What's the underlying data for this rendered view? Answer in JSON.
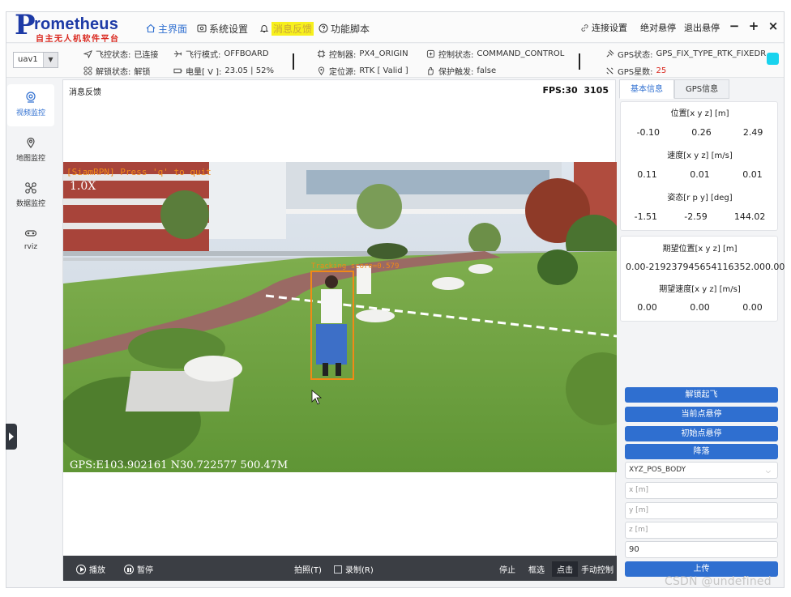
{
  "app": {
    "logo_letter": "P",
    "logo_word": "rometheus",
    "logo_sub": "自主无人机软件平台"
  },
  "nav": {
    "home": "主界面",
    "settings": "系统设置",
    "alerts": "消息反馈",
    "scripts": "功能脚本"
  },
  "topright": {
    "connect": "连接设置",
    "abs_hover": "绝对悬停",
    "exit_hover": "退出悬停",
    "minimize": "−",
    "maximize": "+",
    "close": "×"
  },
  "status": {
    "uav_select": "uav1",
    "fc_state_label": "飞控状态:",
    "fc_state_value": "已连接",
    "flight_mode_label": "飞行模式:",
    "flight_mode_value": "OFFBOARD",
    "controller_label": "控制器:",
    "controller_value": "PX4_ORIGIN",
    "control_state_label": "控制状态:",
    "control_state_value": "COMMAND_CONTROL",
    "gps_state_label": "GPS状态:",
    "gps_state_value": "GPS_FIX_TYPE_RTK_FIXEDR",
    "unlock_label": "解锁状态:",
    "unlock_value": "解锁",
    "battery_label": "电量[ V ]:",
    "battery_value": "23.05 | 52%",
    "position_src_label": "定位源:",
    "position_src_value": "RTK [ Valid ]",
    "protect_label": "保护触发:",
    "protect_value": "false",
    "gps_sat_label": "GPS星数:",
    "gps_sat_value": "25",
    "indicator_color": "#19d3ee"
  },
  "sidebar": {
    "items": [
      {
        "label": "视频监控",
        "icon": "camera-icon"
      },
      {
        "label": "地图监控",
        "icon": "map-pin-icon"
      },
      {
        "label": "数据监控",
        "icon": "drone-icon"
      },
      {
        "label": "rviz",
        "icon": "rviz-icon"
      }
    ]
  },
  "video": {
    "title": "消息反馈",
    "fps": "FPS:30",
    "frame": "3105",
    "overlay_zoom": "1.0X",
    "overlay_track_label": "Tracking  score=0.579",
    "overlay_gps": "GPS:E103.902161 N30.722577  500.47M",
    "overlay_top": "[SiamRPN] Press 'q' to quit"
  },
  "controls": {
    "play": "播放",
    "pause": "暂停",
    "snapshot": "拍照(T)",
    "record": "录制(R)",
    "stop": "停止",
    "box_select": "框选",
    "click": "点击",
    "manual": "手动控制"
  },
  "right_panel": {
    "tab_basic": "基本信息",
    "tab_gps": "GPS信息",
    "pos_header": "位置[x y z] [m]",
    "pos": [
      "-0.10",
      "0.26",
      "2.49"
    ],
    "vel_header": "速度[x y z] [m/s]",
    "vel": [
      "0.11",
      "0.01",
      "0.01"
    ],
    "att_header": "姿态[r p y] [deg]",
    "att": [
      "-1.51",
      "-2.59",
      "144.02"
    ],
    "des_pos_header": "期望位置[x y z] [m]",
    "des_pos": [
      "0.00",
      "-219237945654116352.00",
      "0.00"
    ],
    "des_vel_header": "期望速度[x y z] [m/s]",
    "des_vel": [
      "0.00",
      "0.00",
      "0.00"
    ]
  },
  "actions": {
    "arm_takeoff": "解锁起飞",
    "hover_current": "当前点悬停",
    "hover_initial": "初始点悬停",
    "land": "降落",
    "mode_select": "XYZ_POS_BODY",
    "x_placeholder": "x [m]",
    "y_placeholder": "y [m]",
    "z_placeholder": "z [m]",
    "yaw_value": "90",
    "upload": "上传"
  },
  "watermark": "CSDN @undefined"
}
